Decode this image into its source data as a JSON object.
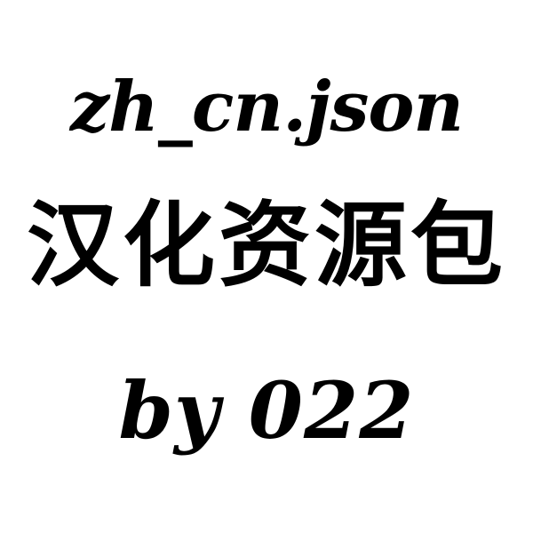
{
  "title": "zh_cn.json",
  "subtitle": "汉化资源包",
  "byline": "by 022",
  "colors": {
    "background": "#ffffff",
    "text": "#000000"
  }
}
